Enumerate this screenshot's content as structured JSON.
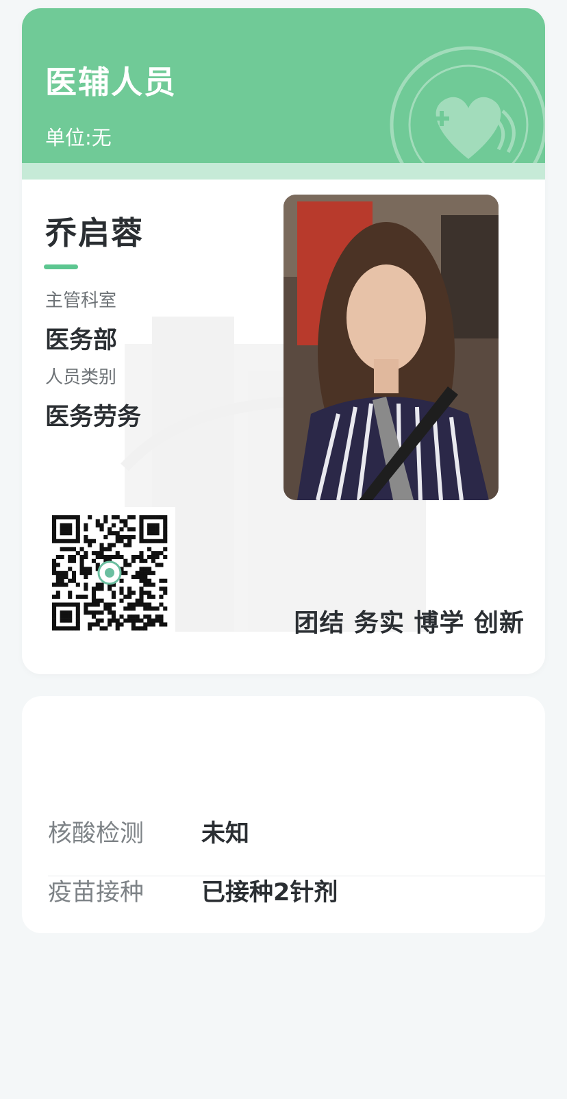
{
  "card": {
    "role_title": "医辅人员",
    "unit": "单位:无",
    "name": "乔启蓉",
    "fields": [
      {
        "label": "主管科室",
        "value": "医务部"
      },
      {
        "label": "人员类别",
        "value": "医务劳务"
      }
    ],
    "motto": "团结 务实 博学 创新"
  },
  "health": {
    "rows": [
      {
        "label": "核酸检测",
        "value": "未知"
      },
      {
        "label": "疫苗接种",
        "value": "已接种2针剂"
      }
    ]
  },
  "colors": {
    "header_green": "#70ca97",
    "accent_green": "#5cc690",
    "page_background": "#f4f7f8"
  }
}
